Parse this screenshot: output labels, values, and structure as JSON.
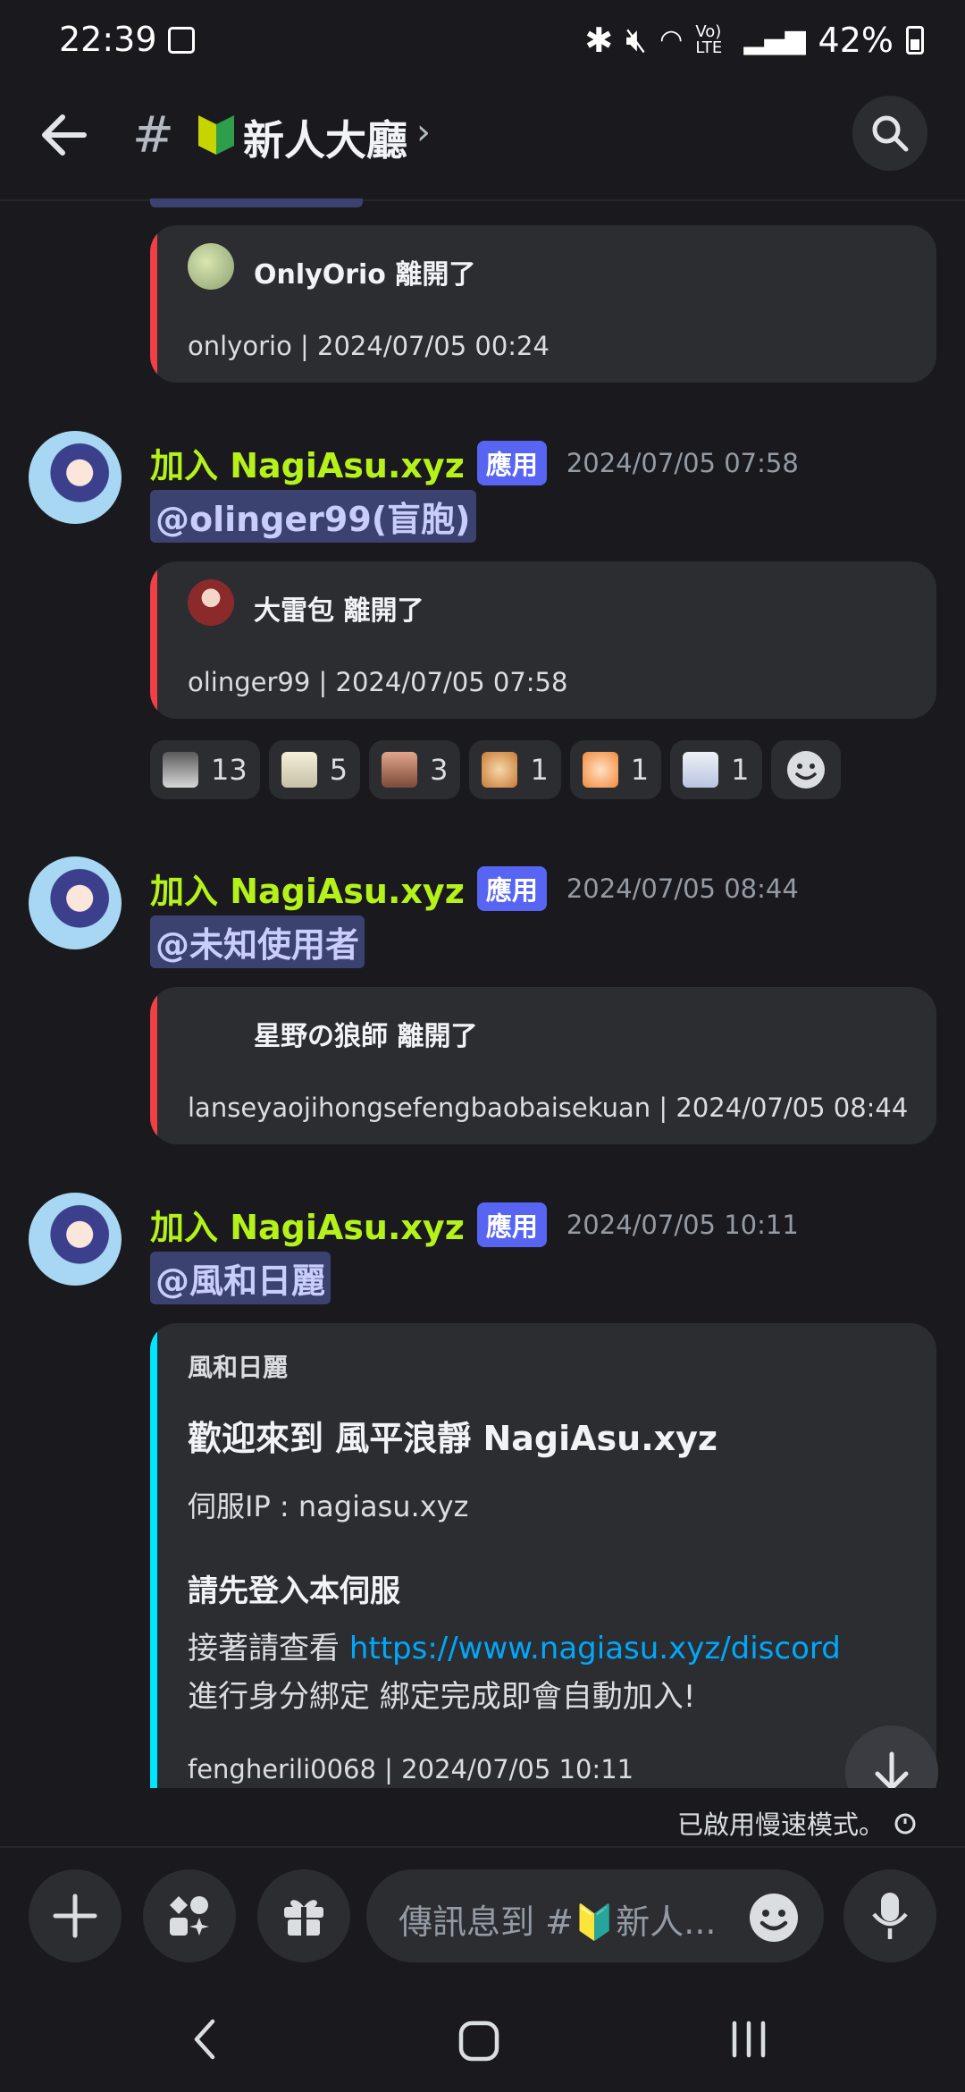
{
  "status_bar": {
    "time": "22:39",
    "battery": "42%",
    "icons": [
      "image-icon",
      "bluetooth-icon",
      "mute-icon",
      "wifi-icon",
      "volte-icon",
      "signal-icon",
      "battery-icon"
    ],
    "volte_text": "Vo) LTE"
  },
  "header": {
    "hash": "#",
    "channel_emoji": "beginner-badge-icon",
    "title": "新人大廳",
    "chevron": "›"
  },
  "messages": [
    {
      "embed": {
        "name": "OnlyOrio 離開了",
        "footer": "onlyorio | 2024/07/05 00:24",
        "bar_color": "#f23f43"
      }
    },
    {
      "author": "加入 NagiAsu.xyz",
      "tag": "應用",
      "timestamp": "2024/07/05 07:58",
      "mention": "@olinger99(盲胞)",
      "embed": {
        "name": "大雷包 離開了",
        "footer": "olinger99 | 2024/07/05 07:58",
        "bar_color": "#f23f43"
      },
      "reactions": [
        {
          "emoji": "cat-face-emoji",
          "count": "13"
        },
        {
          "emoji": "anime-face-emoji",
          "count": "5"
        },
        {
          "emoji": "meme-emoji",
          "count": "3"
        },
        {
          "emoji": "shiba-emoji",
          "count": "1"
        },
        {
          "emoji": "frown-face-emoji",
          "count": "1"
        },
        {
          "emoji": "white-hair-girl-emoji",
          "count": "1"
        }
      ]
    },
    {
      "author": "加入 NagiAsu.xyz",
      "tag": "應用",
      "timestamp": "2024/07/05 08:44",
      "mention": "@未知使用者",
      "embed": {
        "name": "星野の狼師 離開了",
        "footer": "lanseyaojihongsefengbaobaisekuan | 2024/07/05 08:44",
        "bar_color": "#f23f43"
      }
    },
    {
      "author": "加入 NagiAsu.xyz",
      "tag": "應用",
      "timestamp": "2024/07/05 10:11",
      "mention": "@風和日麗",
      "embed": {
        "author": "風和日麗",
        "title": "歡迎來到 風平浪靜 NagiAsu.xyz",
        "line1": "伺服IP : nagiasu.xyz",
        "section_title": "請先登入本伺服",
        "line2_prefix": "接著請查看 ",
        "link": "https://www.nagiasu.xyz/discord",
        "line3": "進行身分綁定 綁定完成即會自動加入!",
        "footer": "fengherili0068 | 2024/07/05 10:11",
        "bar_color": "#00e5ff"
      }
    }
  ],
  "slow_mode": "已啟用慢速模式。",
  "composer": {
    "placeholder": "傳訊息到 #🔰新人..."
  },
  "colors": {
    "background": "#1a1a1e",
    "embed": "#2b2d31",
    "author": "#b5f21a",
    "tag": "#5865f2",
    "link": "#00a8fc"
  }
}
